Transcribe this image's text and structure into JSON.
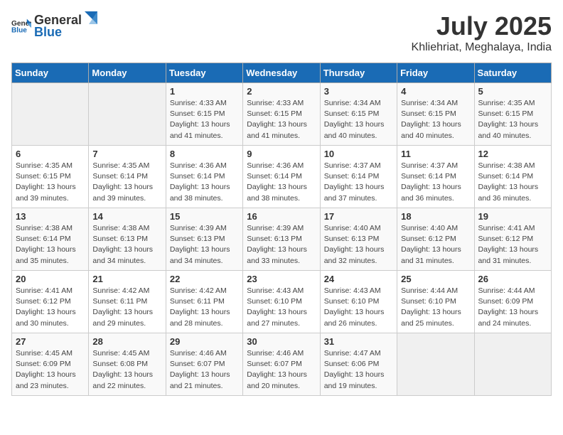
{
  "header": {
    "logo_general": "General",
    "logo_blue": "Blue",
    "month": "July 2025",
    "location": "Khliehriat, Meghalaya, India"
  },
  "days_of_week": [
    "Sunday",
    "Monday",
    "Tuesday",
    "Wednesday",
    "Thursday",
    "Friday",
    "Saturday"
  ],
  "weeks": [
    [
      {
        "day": "",
        "detail": ""
      },
      {
        "day": "",
        "detail": ""
      },
      {
        "day": "1",
        "detail": "Sunrise: 4:33 AM\nSunset: 6:15 PM\nDaylight: 13 hours and 41 minutes."
      },
      {
        "day": "2",
        "detail": "Sunrise: 4:33 AM\nSunset: 6:15 PM\nDaylight: 13 hours and 41 minutes."
      },
      {
        "day": "3",
        "detail": "Sunrise: 4:34 AM\nSunset: 6:15 PM\nDaylight: 13 hours and 40 minutes."
      },
      {
        "day": "4",
        "detail": "Sunrise: 4:34 AM\nSunset: 6:15 PM\nDaylight: 13 hours and 40 minutes."
      },
      {
        "day": "5",
        "detail": "Sunrise: 4:35 AM\nSunset: 6:15 PM\nDaylight: 13 hours and 40 minutes."
      }
    ],
    [
      {
        "day": "6",
        "detail": "Sunrise: 4:35 AM\nSunset: 6:15 PM\nDaylight: 13 hours and 39 minutes."
      },
      {
        "day": "7",
        "detail": "Sunrise: 4:35 AM\nSunset: 6:14 PM\nDaylight: 13 hours and 39 minutes."
      },
      {
        "day": "8",
        "detail": "Sunrise: 4:36 AM\nSunset: 6:14 PM\nDaylight: 13 hours and 38 minutes."
      },
      {
        "day": "9",
        "detail": "Sunrise: 4:36 AM\nSunset: 6:14 PM\nDaylight: 13 hours and 38 minutes."
      },
      {
        "day": "10",
        "detail": "Sunrise: 4:37 AM\nSunset: 6:14 PM\nDaylight: 13 hours and 37 minutes."
      },
      {
        "day": "11",
        "detail": "Sunrise: 4:37 AM\nSunset: 6:14 PM\nDaylight: 13 hours and 36 minutes."
      },
      {
        "day": "12",
        "detail": "Sunrise: 4:38 AM\nSunset: 6:14 PM\nDaylight: 13 hours and 36 minutes."
      }
    ],
    [
      {
        "day": "13",
        "detail": "Sunrise: 4:38 AM\nSunset: 6:14 PM\nDaylight: 13 hours and 35 minutes."
      },
      {
        "day": "14",
        "detail": "Sunrise: 4:38 AM\nSunset: 6:13 PM\nDaylight: 13 hours and 34 minutes."
      },
      {
        "day": "15",
        "detail": "Sunrise: 4:39 AM\nSunset: 6:13 PM\nDaylight: 13 hours and 34 minutes."
      },
      {
        "day": "16",
        "detail": "Sunrise: 4:39 AM\nSunset: 6:13 PM\nDaylight: 13 hours and 33 minutes."
      },
      {
        "day": "17",
        "detail": "Sunrise: 4:40 AM\nSunset: 6:13 PM\nDaylight: 13 hours and 32 minutes."
      },
      {
        "day": "18",
        "detail": "Sunrise: 4:40 AM\nSunset: 6:12 PM\nDaylight: 13 hours and 31 minutes."
      },
      {
        "day": "19",
        "detail": "Sunrise: 4:41 AM\nSunset: 6:12 PM\nDaylight: 13 hours and 31 minutes."
      }
    ],
    [
      {
        "day": "20",
        "detail": "Sunrise: 4:41 AM\nSunset: 6:12 PM\nDaylight: 13 hours and 30 minutes."
      },
      {
        "day": "21",
        "detail": "Sunrise: 4:42 AM\nSunset: 6:11 PM\nDaylight: 13 hours and 29 minutes."
      },
      {
        "day": "22",
        "detail": "Sunrise: 4:42 AM\nSunset: 6:11 PM\nDaylight: 13 hours and 28 minutes."
      },
      {
        "day": "23",
        "detail": "Sunrise: 4:43 AM\nSunset: 6:10 PM\nDaylight: 13 hours and 27 minutes."
      },
      {
        "day": "24",
        "detail": "Sunrise: 4:43 AM\nSunset: 6:10 PM\nDaylight: 13 hours and 26 minutes."
      },
      {
        "day": "25",
        "detail": "Sunrise: 4:44 AM\nSunset: 6:10 PM\nDaylight: 13 hours and 25 minutes."
      },
      {
        "day": "26",
        "detail": "Sunrise: 4:44 AM\nSunset: 6:09 PM\nDaylight: 13 hours and 24 minutes."
      }
    ],
    [
      {
        "day": "27",
        "detail": "Sunrise: 4:45 AM\nSunset: 6:09 PM\nDaylight: 13 hours and 23 minutes."
      },
      {
        "day": "28",
        "detail": "Sunrise: 4:45 AM\nSunset: 6:08 PM\nDaylight: 13 hours and 22 minutes."
      },
      {
        "day": "29",
        "detail": "Sunrise: 4:46 AM\nSunset: 6:07 PM\nDaylight: 13 hours and 21 minutes."
      },
      {
        "day": "30",
        "detail": "Sunrise: 4:46 AM\nSunset: 6:07 PM\nDaylight: 13 hours and 20 minutes."
      },
      {
        "day": "31",
        "detail": "Sunrise: 4:47 AM\nSunset: 6:06 PM\nDaylight: 13 hours and 19 minutes."
      },
      {
        "day": "",
        "detail": ""
      },
      {
        "day": "",
        "detail": ""
      }
    ]
  ]
}
